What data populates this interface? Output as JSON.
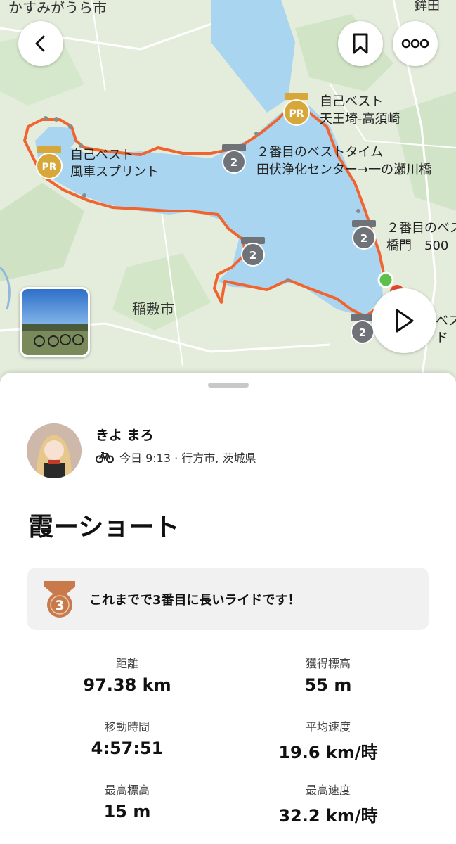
{
  "map": {
    "place_labels": {
      "kasumigaura": "かすみがうら市",
      "inashiki": "稲敷市",
      "hokota_partial": "鉾田"
    },
    "markers": {
      "pr_tennozaki": {
        "line1": "自己ベスト",
        "line2": "天王埼-高須崎",
        "badge": "PR"
      },
      "pr_fusha": {
        "line1": "自己ベスト",
        "line2": "風車スプリント",
        "badge": "PR"
      },
      "second_tabuse": {
        "line1": "２番目のベストタイム",
        "line2": "田伏浄化センター→一の瀬川橋",
        "badge": "2"
      },
      "second_east": {
        "line1": "２番目のべス",
        "line2": "橋門　500",
        "badge": "2"
      },
      "second_south": {
        "badge": "2"
      },
      "second_middle": {
        "badge": "2"
      },
      "partial_right": {
        "line1": "べス",
        "line2": "ド"
      }
    }
  },
  "toolbar": {
    "back_icon": "chevron-left-icon",
    "bookmark_icon": "bookmark-icon",
    "more_icon": "more-options-icon",
    "play_icon": "play-icon"
  },
  "athlete": {
    "name": "きよ まろ",
    "activity_icon": "bike-icon",
    "meta": "今日 9:13 · 行方市, 茨城県"
  },
  "activity": {
    "title": "霞ーショート"
  },
  "achievement": {
    "icon": "bronze-medal-icon",
    "rank": "3",
    "text": "これまでで3番目に長いライドです！"
  },
  "stats": [
    {
      "label": "距離",
      "value": "97.38 km"
    },
    {
      "label": "獲得標高",
      "value": "55 m"
    },
    {
      "label": "移動時間",
      "value": "4:57:51"
    },
    {
      "label": "平均速度",
      "value": "19.6 km/時"
    },
    {
      "label": "最高標高",
      "value": "15 m"
    },
    {
      "label": "最高速度",
      "value": "32.2 km/時"
    }
  ],
  "colors": {
    "route": "#f0652f",
    "water": "#a9d5f0",
    "land": "#e3ebd9",
    "pr_gold": "#d8a73a",
    "silver": "#6f7378",
    "bronze": "#c97a4a",
    "start": "#5cc04a"
  }
}
